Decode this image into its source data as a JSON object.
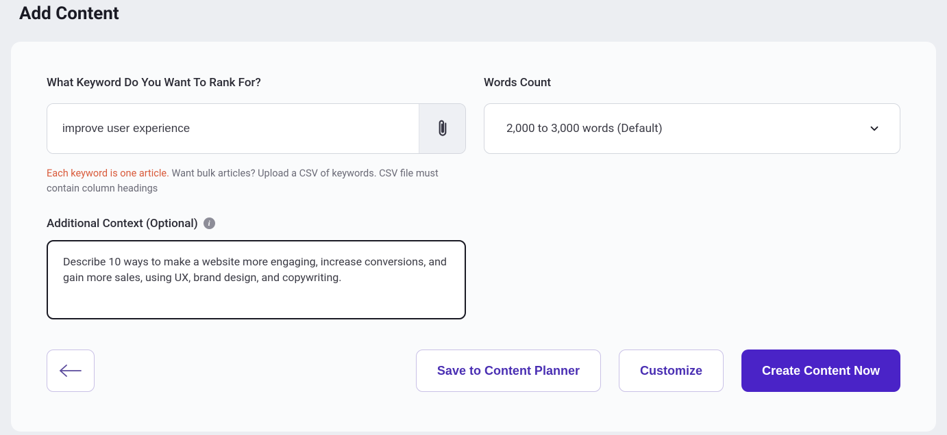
{
  "header": {
    "title": "Add Content"
  },
  "keyword": {
    "label": "What Keyword Do You Want To Rank For?",
    "value": "improve user experience",
    "help_emphasis": "Each keyword is one article.",
    "help_rest": " Want bulk articles? Upload a CSV of keywords. CSV file must contain column headings"
  },
  "words_count": {
    "label": "Words Count",
    "selected": "2,000 to 3,000 words (Default)"
  },
  "context": {
    "label": "Additional Context (Optional)",
    "value": "Describe 10 ways to make a website more engaging, increase conversions, and gain more sales, using UX, brand design, and copywriting."
  },
  "footer": {
    "save_label": "Save to Content Planner",
    "customize_label": "Customize",
    "create_label": "Create Content Now"
  },
  "icons": {
    "attach": "paperclip-icon",
    "chevron": "chevron-down-icon",
    "back": "arrow-left-icon",
    "info": "info-icon"
  }
}
